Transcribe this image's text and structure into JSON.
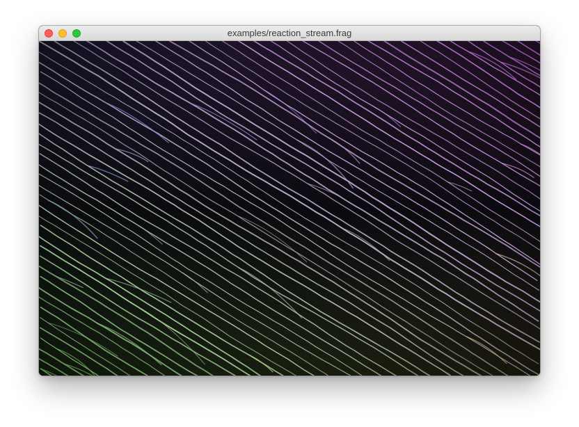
{
  "window": {
    "title": "examples/reaction_stream.frag",
    "controls": {
      "close": "close-button",
      "minimize": "minimize-button",
      "zoom": "zoom-button"
    }
  },
  "render": {
    "shader": "reaction_stream",
    "colors": {
      "top_left": "#7b7cff",
      "top_right": "#e07bff",
      "bottom_left": "#8fe07a",
      "bottom_right": "#f2ea8a",
      "background": "#0b0b0e"
    }
  }
}
